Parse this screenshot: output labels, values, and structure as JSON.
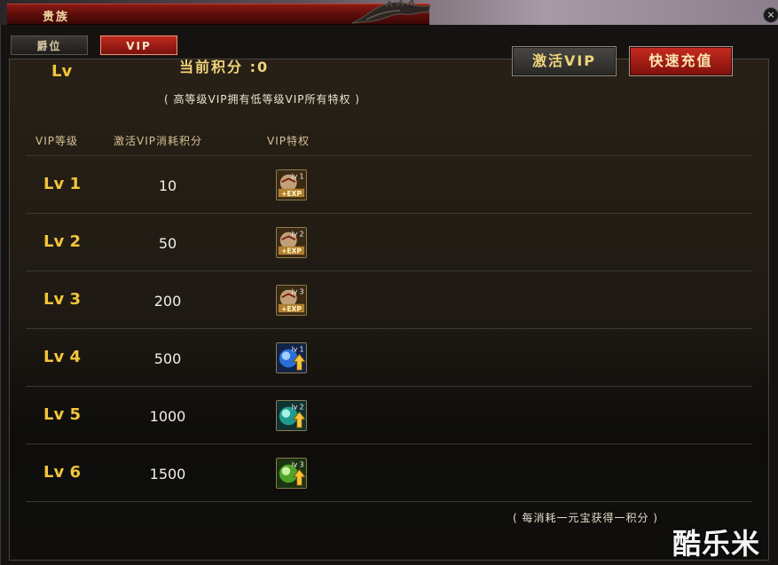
{
  "window": {
    "title": "贵族",
    "close": "×"
  },
  "tabs": [
    {
      "label": "爵位",
      "active": false
    },
    {
      "label": "VIP",
      "active": true
    }
  ],
  "header": {
    "level_label": "Lv",
    "points_text": "当前积分 :0",
    "note": "( 高等级VIP拥有低等级VIP所有特权 )",
    "activate_button": "激活VIP",
    "recharge_button": "快速充值"
  },
  "table": {
    "columns": [
      "VIP等级",
      "激活VIP消耗积分",
      "VIP特权"
    ],
    "rows": [
      {
        "level": "Lv 1",
        "cost": "10",
        "icon": "exp-boost-lv1-icon",
        "icon_tag": "lv 1"
      },
      {
        "level": "Lv 2",
        "cost": "50",
        "icon": "exp-boost-lv2-icon",
        "icon_tag": "lv 2"
      },
      {
        "level": "Lv 3",
        "cost": "200",
        "icon": "exp-boost-lv3-icon",
        "icon_tag": "lv 3"
      },
      {
        "level": "Lv 4",
        "cost": "500",
        "icon": "upgrade-orb-lv1-icon",
        "icon_tag": "lv 1"
      },
      {
        "level": "Lv 5",
        "cost": "1000",
        "icon": "upgrade-orb-lv2-icon",
        "icon_tag": "lv 2"
      },
      {
        "level": "Lv 6",
        "cost": "1500",
        "icon": "upgrade-orb-lv3-icon",
        "icon_tag": "lv 3"
      }
    ]
  },
  "footer_note": "( 每消耗一元宝获得一积分 )",
  "watermark": "酷乐米",
  "colors": {
    "gold_text": "#f2c53a",
    "red_button": "#c82b21",
    "panel_bg": "#0f0e0c"
  }
}
